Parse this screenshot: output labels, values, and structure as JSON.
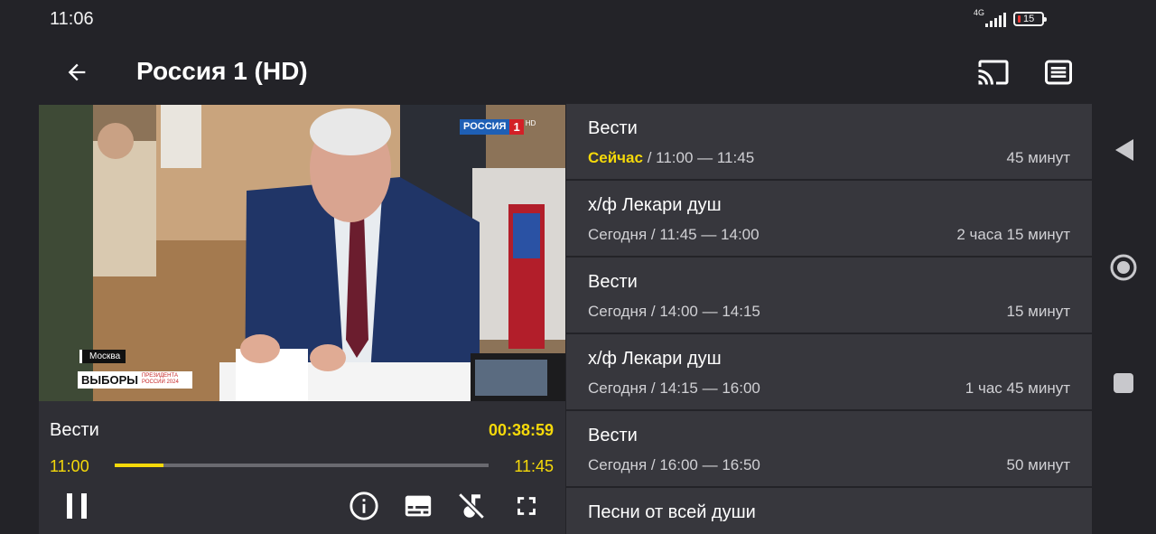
{
  "status_bar": {
    "time": "11:06",
    "network": "4G",
    "battery": "15"
  },
  "app_bar": {
    "title": "Россия 1 (HD)",
    "icons": [
      "back-arrow-icon",
      "cast-icon",
      "list-icon"
    ]
  },
  "video": {
    "channel_logo": "РОССИЯ",
    "channel_number": "1",
    "channel_hd": "HD",
    "location": "Москва",
    "election_title": "ВЫБОРЫ",
    "election_subtitle": "ПРЕЗИДЕНТА РОССИИ 2024"
  },
  "player": {
    "title": "Вести",
    "elapsed": "00:38:59",
    "start": "11:00",
    "end": "11:45",
    "progress": 0.131,
    "controls": [
      "pause-icon",
      "info-icon",
      "subtitles-icon",
      "audio-off-icon",
      "fullscreen-icon"
    ]
  },
  "programs": [
    {
      "title": "Вести",
      "day": "Сейчас",
      "time": " / 11:00 — 11:45",
      "duration": "45 минут",
      "current": true
    },
    {
      "title": "х/ф Лекари душ",
      "day": "Сегодня",
      "time": " / 11:45 — 14:00",
      "duration": "2 часа 15 минут"
    },
    {
      "title": "Вести",
      "day": "Сегодня",
      "time": " / 14:00 — 14:15",
      "duration": "15 минут"
    },
    {
      "title": "х/ф Лекари душ",
      "day": "Сегодня",
      "time": " / 14:15 — 16:00",
      "duration": "1 час 45 минут"
    },
    {
      "title": "Вести",
      "day": "Сегодня",
      "time": " / 16:00 — 16:50",
      "duration": "50 минут"
    },
    {
      "title": "Песни от всей души"
    }
  ],
  "colors": {
    "accent": "#f5d90a",
    "background": "#232328",
    "card": "#37373d",
    "player_panel": "#2f2f35"
  }
}
